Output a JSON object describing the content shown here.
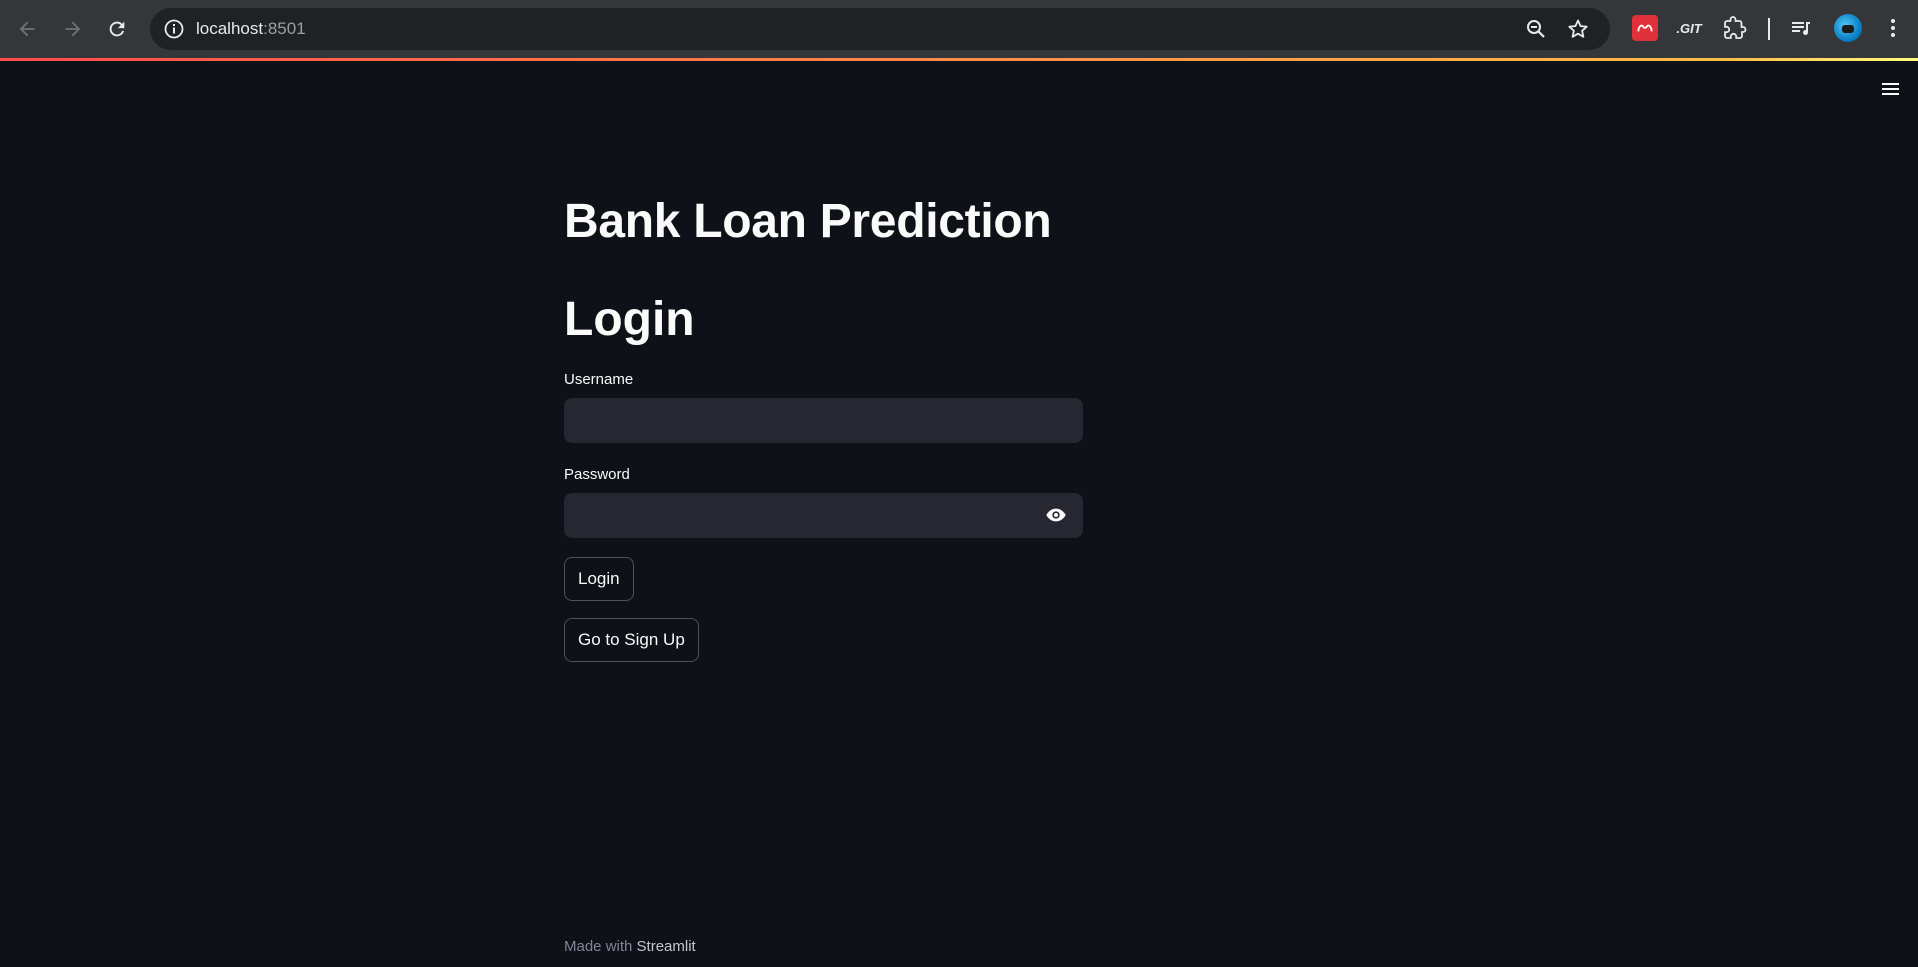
{
  "browser": {
    "url_host": "localhost",
    "url_port": ":8501"
  },
  "app": {
    "title": "Bank Loan Prediction",
    "subtitle": "Login",
    "username_label": "Username",
    "username_value": "",
    "password_label": "Password",
    "password_value": "",
    "login_button": "Login",
    "signup_button": "Go to Sign Up"
  },
  "footer": {
    "prefix": "Made with ",
    "brand": "Streamlit"
  },
  "colors": {
    "background": "#0e1117",
    "input_bg": "#262730",
    "text": "#fafafa",
    "accent_gradient_start": "#ff4b4b",
    "accent_gradient_end": "#fffd80"
  },
  "icons": [
    "back-icon",
    "forward-icon",
    "reload-icon",
    "info-icon",
    "zoom-out-icon",
    "star-icon",
    "mendeley-extension-icon",
    "git-extension-icon",
    "extensions-puzzle-icon",
    "media-control-icon",
    "profile-avatar",
    "chrome-menu-icon",
    "hamburger-menu-icon",
    "eye-icon"
  ]
}
